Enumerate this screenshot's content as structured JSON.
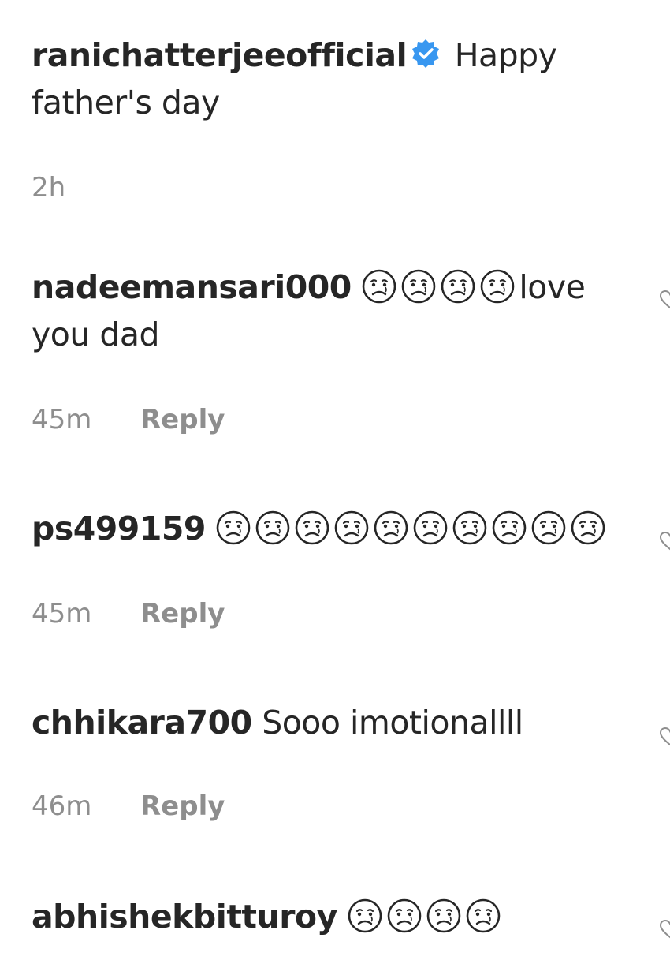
{
  "comments": [
    {
      "username": "ranichatterjeeofficial",
      "verified": true,
      "text_before": "Happy",
      "text_line2": "father's day",
      "time": "2h"
    },
    {
      "username": "nadeemansari000",
      "emoji_count": 4,
      "text_after": "love",
      "text_line2": "you dad",
      "time": "45m",
      "reply": "Reply"
    },
    {
      "username": "ps499159",
      "emoji_count": 10,
      "time": "45m",
      "reply": "Reply"
    },
    {
      "username": "chhikara700",
      "text": "Sooo imotionallll",
      "time": "46m",
      "reply": "Reply"
    },
    {
      "username": "abhishekbitturoy",
      "emoji_count": 4
    }
  ],
  "icons": {
    "verified_badge": "verified-badge-icon",
    "emoji": "sad-face-emoji-icon",
    "like": "heart-icon"
  },
  "colors": {
    "text": "#262626",
    "muted": "#8e8e8e",
    "verified": "#3897f0"
  }
}
